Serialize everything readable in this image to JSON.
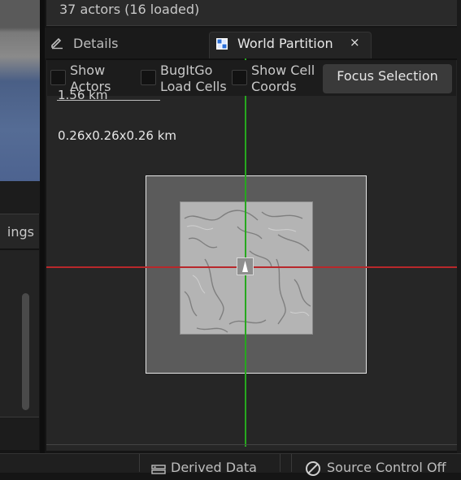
{
  "outliner": {
    "actors_count": "37 actors (16 loaded)"
  },
  "left_panel": {
    "tab_label": "ings"
  },
  "tabs": {
    "details_label": "Details",
    "world_partition_label": "World Partition",
    "close_glyph": "×",
    "details_icon": "pencil-icon",
    "world_partition_icon": "grid-icon"
  },
  "toolbar": {
    "show_actors": {
      "line1": "Show",
      "line2": "Actors",
      "checked": false
    },
    "bugitgo_load_cells": {
      "line1": "BugItGo",
      "line2": "Load Cells",
      "checked": false
    },
    "show_cell_coords": {
      "line1": "Show Cell",
      "line2": "Coords",
      "checked": false
    },
    "focus_selection_label": "Focus Selection"
  },
  "minimap": {
    "scale_label": "1.56 km",
    "dims_label": "0.26x0.26x0.26 km",
    "axis_colors": {
      "x": "#b8282b",
      "y": "#27a81f"
    }
  },
  "status_bar": {
    "derived_data_label": "Derived Data",
    "source_control_label": "Source Control Off"
  }
}
